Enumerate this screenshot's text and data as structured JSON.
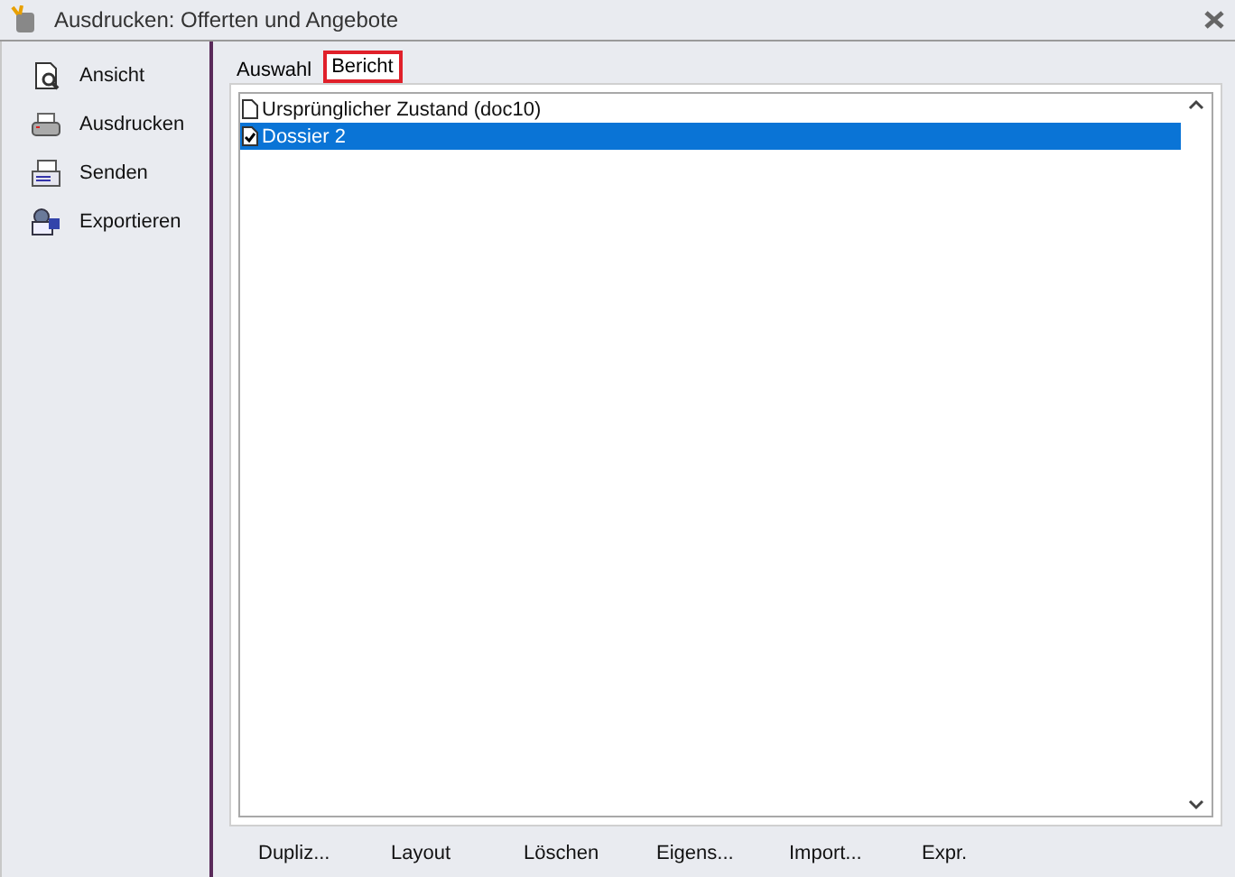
{
  "window": {
    "title": "Ausdrucken: Offerten und Angebote"
  },
  "sidebar": {
    "items": [
      {
        "label": "Ansicht",
        "kind": "preview"
      },
      {
        "label": "Ausdrucken",
        "kind": "printer"
      },
      {
        "label": "Senden",
        "kind": "mail"
      },
      {
        "label": "Exportieren",
        "kind": "export"
      }
    ]
  },
  "tabs": [
    {
      "label": "Auswahl",
      "selected": false
    },
    {
      "label": "Bericht",
      "selected": true
    }
  ],
  "list": {
    "items": [
      {
        "label": "Ursprünglicher Zustand (doc10)",
        "kind": "blank",
        "selected": false
      },
      {
        "label": "Dossier 2",
        "kind": "checked",
        "selected": true
      }
    ]
  },
  "buttons": [
    "Dupliz...",
    "Layout",
    "Löschen",
    "Eigens...",
    "Import...",
    "Expr."
  ]
}
